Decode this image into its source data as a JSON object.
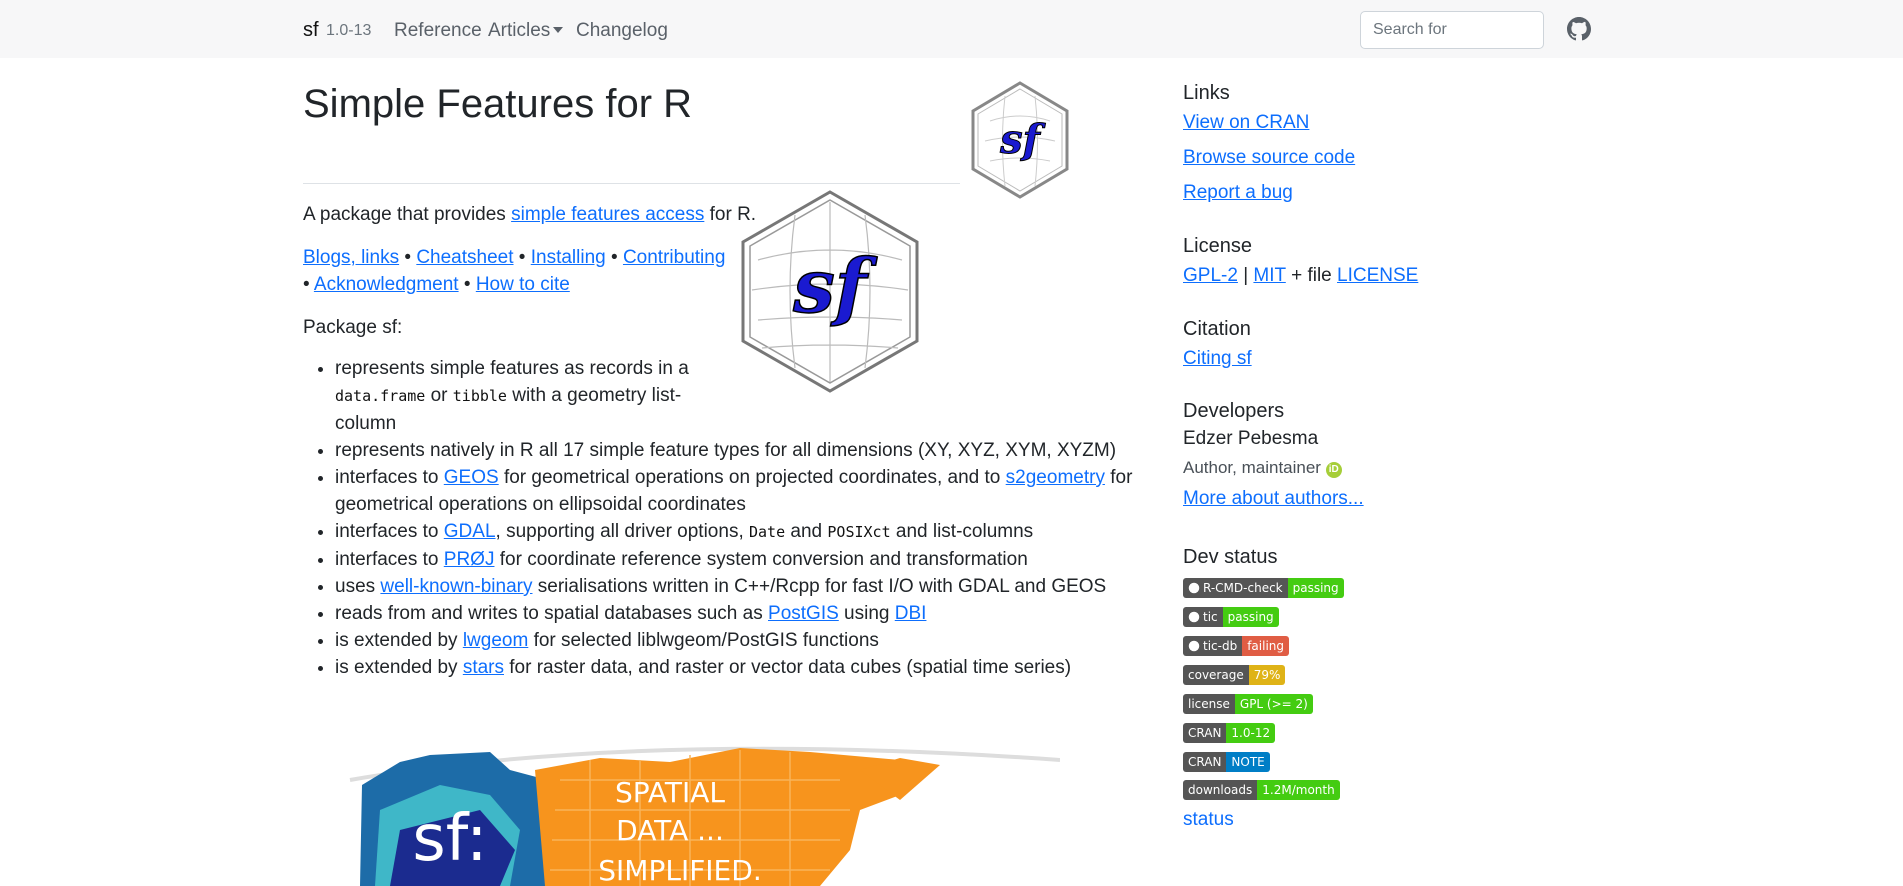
{
  "nav": {
    "brand": "sf",
    "version": "1.0-13",
    "links": [
      "Reference",
      "Articles",
      "Changelog"
    ],
    "search_placeholder": "Search for"
  },
  "main": {
    "title": "Simple Features for R",
    "intro_prefix": "A package that provides ",
    "intro_link": "simple features access",
    "intro_suffix": " for R.",
    "quick_links": [
      "Blogs, links",
      "Cheatsheet",
      "Installing",
      "Contributing",
      "Acknowledgment",
      "How to cite"
    ],
    "bullet_sep": "•",
    "package_label": "Package sf:",
    "logo_text": "sf",
    "features": [
      {
        "parts": [
          {
            "t": "represents simple features as records in a "
          },
          {
            "c": "data.frame"
          },
          {
            "t": " or "
          },
          {
            "c": "tibble"
          },
          {
            "t": " with a geometry list-column"
          }
        ]
      },
      {
        "parts": [
          {
            "t": "represents natively in R all 17 simple feature types for all dimensions (XY, XYZ, XYM, XYZM)"
          }
        ]
      },
      {
        "parts": [
          {
            "t": "interfaces to "
          },
          {
            "l": "GEOS"
          },
          {
            "t": " for geometrical operations on projected coordinates, and to "
          },
          {
            "l": "s2geometry"
          },
          {
            "t": " for geometrical operations on ellipsoidal coordinates"
          }
        ]
      },
      {
        "parts": [
          {
            "t": "interfaces to "
          },
          {
            "l": "GDAL"
          },
          {
            "t": ", supporting all driver options, "
          },
          {
            "c": "Date"
          },
          {
            "t": " and "
          },
          {
            "c": "POSIXct"
          },
          {
            "t": " and list-columns"
          }
        ]
      },
      {
        "parts": [
          {
            "t": "interfaces to "
          },
          {
            "l": "PRØJ"
          },
          {
            "t": " for coordinate reference system conversion and transformation"
          }
        ]
      },
      {
        "parts": [
          {
            "t": "uses "
          },
          {
            "l": "well-known-binary"
          },
          {
            "t": " serialisations written in C++/Rcpp for fast I/O with GDAL and GEOS"
          }
        ]
      },
      {
        "parts": [
          {
            "t": "reads from and writes to spatial databases such as "
          },
          {
            "l": "PostGIS"
          },
          {
            "t": " using "
          },
          {
            "l": "DBI"
          }
        ]
      },
      {
        "parts": [
          {
            "t": "is extended by "
          },
          {
            "l": "lwgeom"
          },
          {
            "t": " for selected liblwgeom/PostGIS functions"
          }
        ]
      },
      {
        "parts": [
          {
            "t": "is extended by "
          },
          {
            "l": "stars"
          },
          {
            "t": " for raster data, and raster or vector data cubes (spatial time series)"
          }
        ]
      }
    ],
    "banner": {
      "left": "sf:",
      "line1": "SPATIAL",
      "line2": "DATA ...",
      "line3": "SIMPLIFIED."
    }
  },
  "sidebar": {
    "links_heading": "Links",
    "links": [
      "View on CRAN",
      "Browse source code",
      "Report a bug"
    ],
    "license_heading": "License",
    "license": {
      "a": "GPL-2",
      "sep": "|",
      "b": "MIT",
      "mid": "+ file",
      "c": "LICENSE"
    },
    "citation_heading": "Citation",
    "citation_link": "Citing sf",
    "developers_heading": "Developers",
    "developer_name": "Edzer Pebesma",
    "developer_role": "Author, maintainer",
    "orcid_label": "iD",
    "more_authors": "More about authors...",
    "dev_status_heading": "Dev status",
    "badges": [
      {
        "label": "R-CMD-check",
        "value": "passing",
        "color": "#4c1",
        "icon": "github"
      },
      {
        "label": "tic",
        "value": "passing",
        "color": "#4c1",
        "icon": "github"
      },
      {
        "label": "tic-db",
        "value": "failing",
        "color": "#e05d44",
        "icon": "github"
      },
      {
        "label": "coverage",
        "value": "79%",
        "color": "#dfb317",
        "icon": ""
      },
      {
        "label": "license",
        "value": "GPL (>= 2)",
        "color": "#4c1",
        "icon": ""
      },
      {
        "label": "CRAN",
        "value": "1.0-12",
        "color": "#4c1",
        "icon": ""
      },
      {
        "label": "CRAN",
        "value": "NOTE",
        "color": "#007ec6",
        "icon": ""
      },
      {
        "label": "downloads",
        "value": "1.2M/month",
        "color": "#4c1",
        "icon": ""
      }
    ],
    "status_link": "status"
  }
}
